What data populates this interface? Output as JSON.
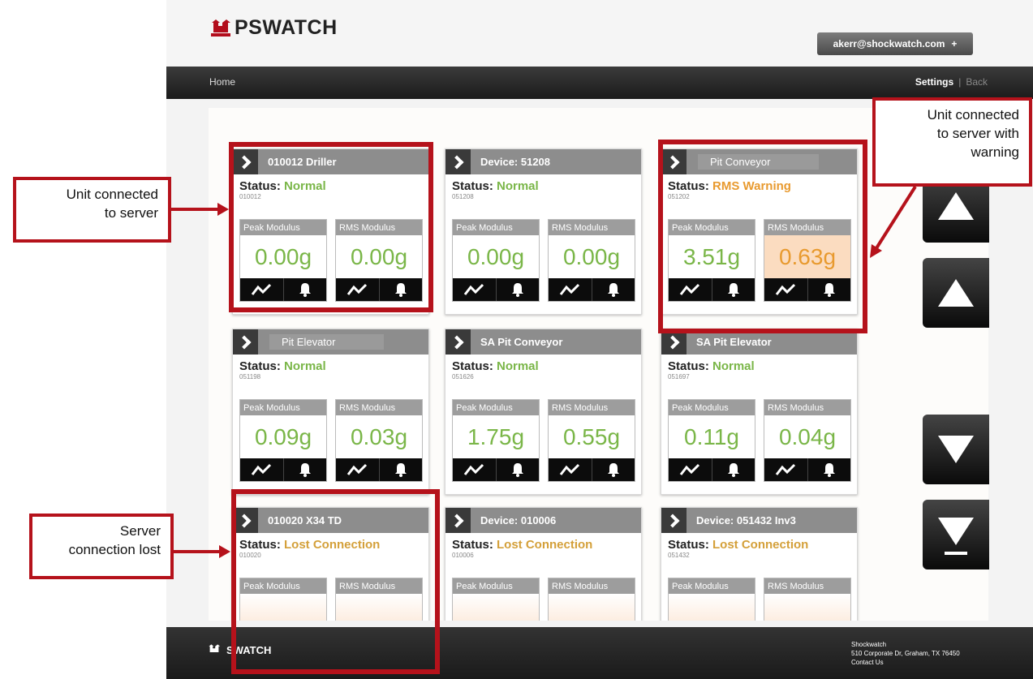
{
  "header": {
    "logo_text": "PSWATCH",
    "user_email": "akerr@shockwatch.com",
    "user_menu_glyph": "+"
  },
  "nav": {
    "home": "Home",
    "settings": "Settings",
    "separator": "|",
    "back": "Back"
  },
  "devices": [
    {
      "title": "010012 Driller",
      "status_label": "Status:",
      "status": "Normal",
      "serial": "010012",
      "peak_label": "Peak Modulus",
      "rms_label": "RMS Modulus",
      "peak": "0.00g",
      "rms": "0.00g"
    },
    {
      "title": "Device: 51208",
      "status_label": "Status:",
      "status": "Normal",
      "serial": "051208",
      "peak_label": "Peak Modulus",
      "rms_label": "RMS Modulus",
      "peak": "0.00g",
      "rms": "0.00g"
    },
    {
      "title": "Pit Conveyor",
      "status_label": "Status:",
      "status": "RMS Warning",
      "serial": "051202",
      "peak_label": "Peak Modulus",
      "rms_label": "RMS Modulus",
      "peak": "3.51g",
      "rms": "0.63g"
    },
    {
      "title": "Pit Elevator",
      "status_label": "Status:",
      "status": "Normal",
      "serial": "051198",
      "peak_label": "Peak Modulus",
      "rms_label": "RMS Modulus",
      "peak": "0.09g",
      "rms": "0.03g"
    },
    {
      "title": "SA Pit Conveyor",
      "status_label": "Status:",
      "status": "Normal",
      "serial": "051626",
      "peak_label": "Peak Modulus",
      "rms_label": "RMS Modulus",
      "peak": "1.75g",
      "rms": "0.55g"
    },
    {
      "title": "SA Pit Elevator",
      "status_label": "Status:",
      "status": "Normal",
      "serial": "051697",
      "peak_label": "Peak Modulus",
      "rms_label": "RMS Modulus",
      "peak": "0.11g",
      "rms": "0.04g"
    },
    {
      "title": "010020 X34 TD",
      "status_label": "Status:",
      "status": "Lost Connection",
      "serial": "010020",
      "peak_label": "Peak Modulus",
      "rms_label": "RMS Modulus",
      "peak": "",
      "rms": ""
    },
    {
      "title": "Device: 010006",
      "status_label": "Status:",
      "status": "Lost Connection",
      "serial": "010006",
      "peak_label": "Peak Modulus",
      "rms_label": "RMS Modulus",
      "peak": "",
      "rms": ""
    },
    {
      "title": "Device: 051432 Inv3",
      "status_label": "Status:",
      "status": "Lost Connection",
      "serial": "051432",
      "peak_label": "Peak Modulus",
      "rms_label": "RMS Modulus",
      "peak": "",
      "rms": ""
    }
  ],
  "footer": {
    "logo_text": "SWATCH",
    "company": "Shockwatch",
    "address": "510 Corporate Dr, Graham, TX 76450",
    "contact": "Contact Us"
  },
  "annotations": {
    "connected_line1": "Unit connected",
    "connected_line2": "to server",
    "warning_line1": "Unit connected",
    "warning_line2": "to server with",
    "warning_line3": "warning",
    "lost_line1": "Server",
    "lost_line2": "connection lost"
  },
  "colors": {
    "normal": "#7ab648",
    "warning": "#e89a2f",
    "lost": "#d4a03a",
    "annotation": "#b5121b"
  },
  "icons": [
    "chevron-right-icon",
    "trend-icon",
    "bell-icon",
    "scroll-top-icon",
    "page-up-icon",
    "page-down-icon",
    "scroll-bottom-icon"
  ]
}
